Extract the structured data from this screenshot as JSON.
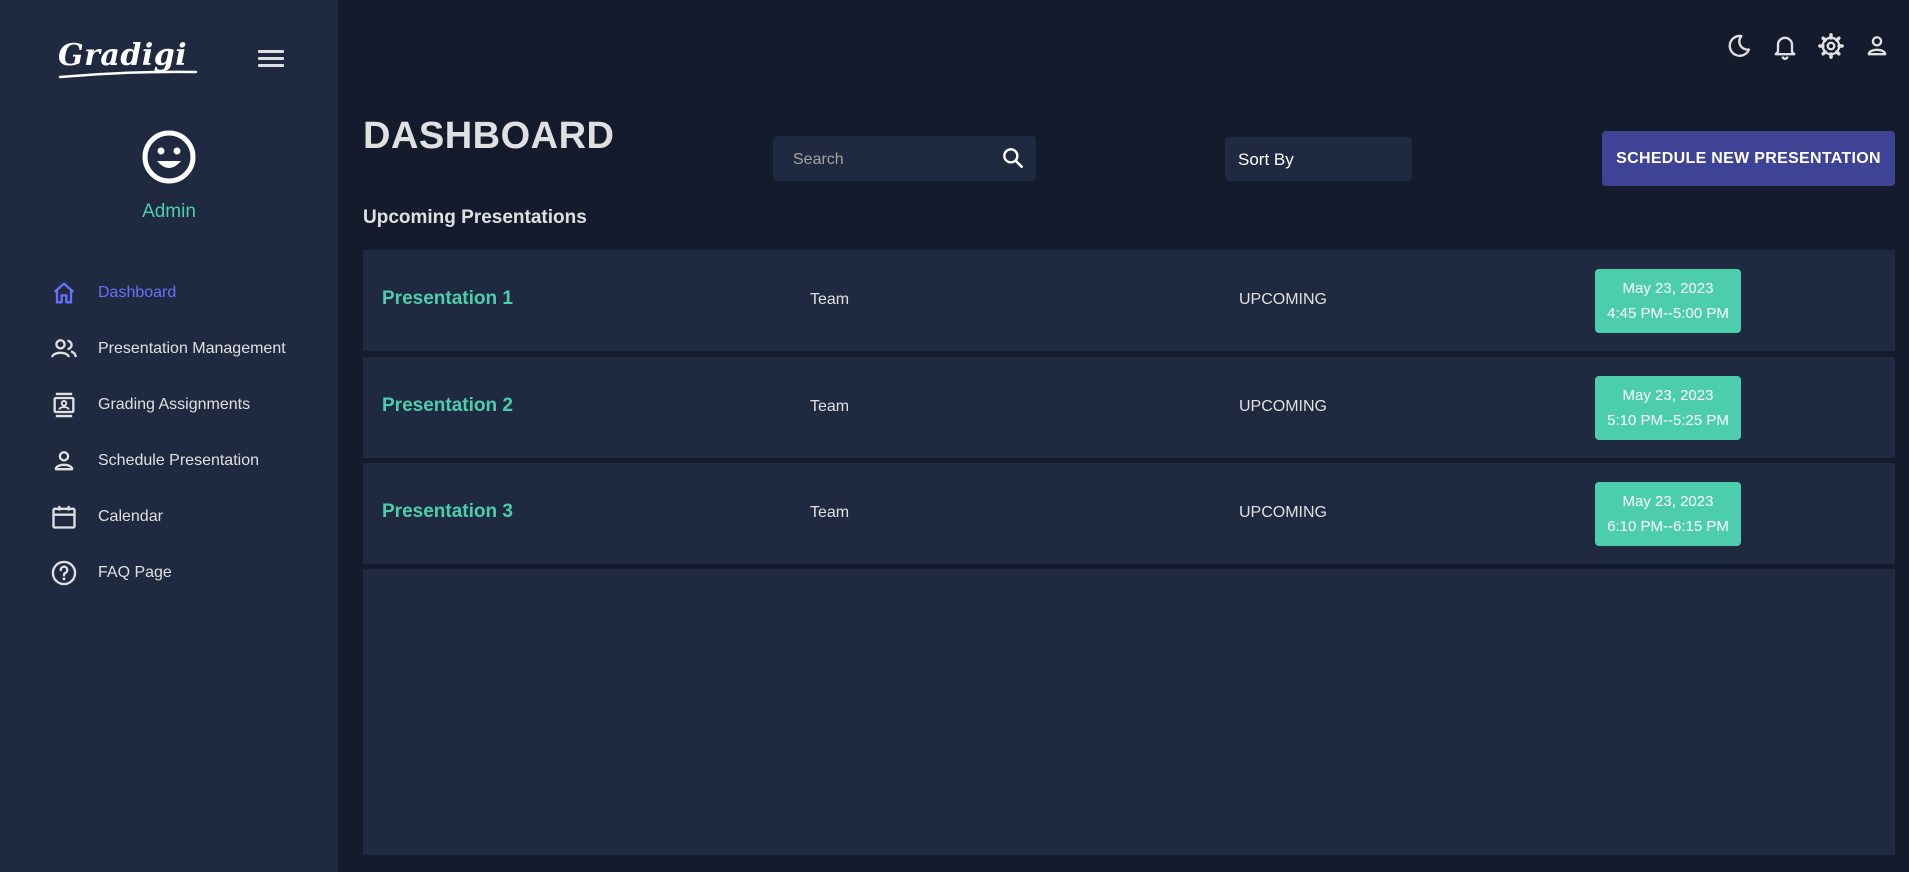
{
  "brand": {
    "logo_text": "Gradigi"
  },
  "user": {
    "name": "Admin",
    "avatar_icon": "smiley-face-icon"
  },
  "sidebar": {
    "items": [
      {
        "label": "Dashboard",
        "icon": "home-icon",
        "active": true
      },
      {
        "label": "Presentation Management",
        "icon": "people-icon"
      },
      {
        "label": "Grading Assignments",
        "icon": "contact-card-icon"
      },
      {
        "label": "Schedule Presentation",
        "icon": "person-icon"
      },
      {
        "label": "Calendar",
        "icon": "calendar-icon"
      },
      {
        "label": "FAQ Page",
        "icon": "help-circle-icon"
      }
    ]
  },
  "topbar": {
    "icons": [
      "dark-mode-icon",
      "notifications-icon",
      "settings-icon",
      "profile-icon"
    ]
  },
  "main": {
    "title": "DASHBOARD",
    "search": {
      "placeholder": "Search"
    },
    "sort": {
      "label": "Sort By"
    },
    "schedule_button": "SCHEDULE NEW PRESENTATION",
    "section_title": "Upcoming Presentations",
    "presentations": [
      {
        "name": "Presentation 1",
        "type": "Team",
        "status": "UPCOMING",
        "date": "May 23, 2023",
        "time": "4:45 PM--5:00 PM"
      },
      {
        "name": "Presentation 2",
        "type": "Team",
        "status": "UPCOMING",
        "date": "May 23, 2023",
        "time": "5:10 PM--5:25 PM"
      },
      {
        "name": "Presentation 3",
        "type": "Team",
        "status": "UPCOMING",
        "date": "May 23, 2023",
        "time": "6:10 PM--6:15 PM"
      }
    ]
  },
  "colors": {
    "background": "#141b2d",
    "panel": "#1f2a40",
    "accent_green": "#4cceac",
    "accent_blue": "#6870fa",
    "button": "#3e4396"
  }
}
